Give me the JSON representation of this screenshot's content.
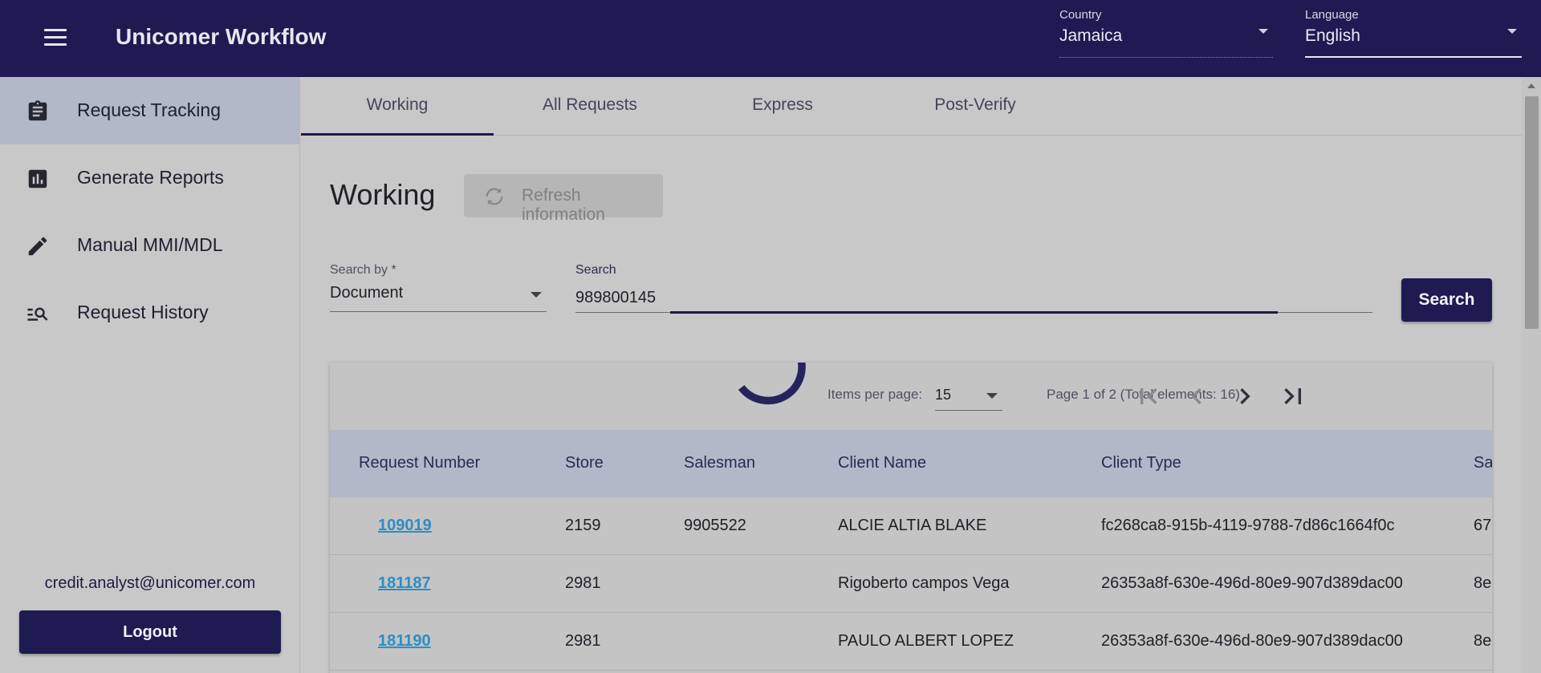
{
  "header": {
    "title": "Unicomer Workflow",
    "country_label": "Country",
    "country_value": "Jamaica",
    "language_label": "Language",
    "language_value": "English"
  },
  "sidebar": {
    "items": [
      {
        "label": "Request Tracking",
        "icon": "clipboard-icon",
        "active": true
      },
      {
        "label": "Generate Reports",
        "icon": "bar-chart-icon",
        "active": false
      },
      {
        "label": "Manual MMI/MDL",
        "icon": "pencil-icon",
        "active": false
      },
      {
        "label": "Request History",
        "icon": "list-search-icon",
        "active": false
      }
    ],
    "user_email": "credit.analyst@unicomer.com",
    "logout_label": "Logout"
  },
  "tabs": [
    "Working",
    "All Requests",
    "Express",
    "Post-Verify"
  ],
  "page": {
    "title": "Working",
    "refresh_label": "Refresh information"
  },
  "search": {
    "by_label": "Search by *",
    "by_value": "Document",
    "input_label": "Search",
    "input_value": "989800145",
    "button_label": "Search"
  },
  "pagination": {
    "items_per_page_label": "Items per page:",
    "items_per_page_value": "15",
    "page_info": "Page 1 of 2 (Total elements: 16)"
  },
  "table": {
    "columns": [
      "Request Number",
      "Store",
      "Salesman",
      "Client Name",
      "Client Type",
      "Sa"
    ],
    "rows": [
      [
        "109019",
        "2159",
        "9905522",
        "ALCIE ALTIA BLAKE",
        "fc268ca8-915b-4119-9788-7d86c1664f0c",
        "67"
      ],
      [
        "181187",
        "2981",
        "",
        "Rigoberto campos Vega",
        "26353a8f-630e-496d-80e9-907d389dac00",
        "8e"
      ],
      [
        "181190",
        "2981",
        "",
        "PAULO ALBERT LOPEZ",
        "26353a8f-630e-496d-80e9-907d389dac00",
        "8e"
      ]
    ]
  },
  "colors": {
    "primary": "#1e1a52",
    "link": "#2e8ec4",
    "table_header": "#b2b8c8",
    "overlay_bg": "#c8c8c8"
  }
}
